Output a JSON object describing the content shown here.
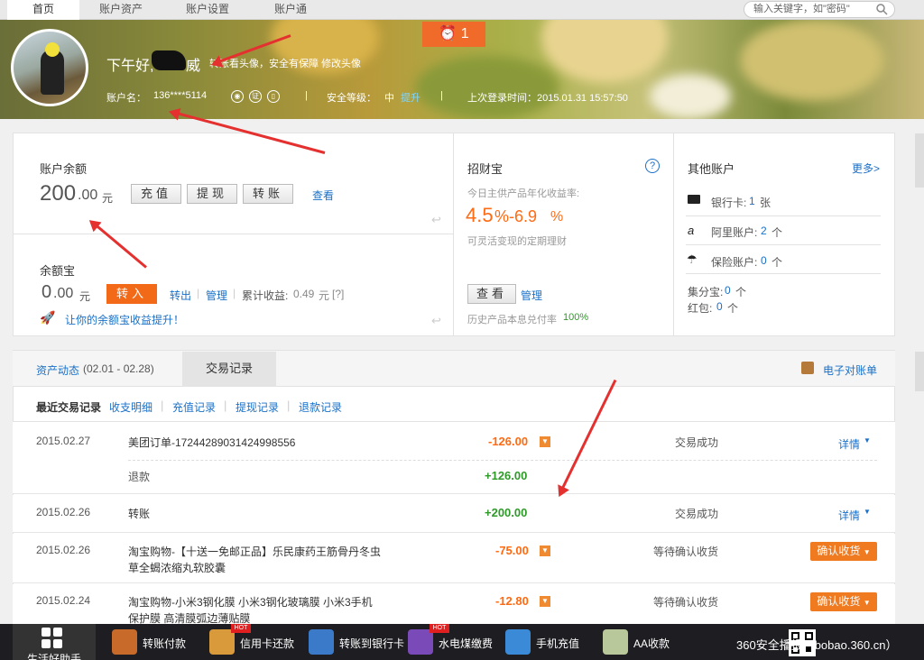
{
  "nav": {
    "tabs": [
      "首页",
      "账户资产",
      "账户设置",
      "账户通"
    ],
    "search_placeholder": "输入关键字，如\"密码\""
  },
  "header": {
    "greeting": "下午好,",
    "name_suffix": "威",
    "note": "转账看头像，安全有保障",
    "change_avatar": "修改头像",
    "account_label": "账户名：",
    "account_value": "136****5114",
    "security_label": "安全等级：",
    "security_level": "中",
    "security_upgrade": "提升",
    "last_login": "上次登录时间：2015.01.31 15:57:50",
    "alarm_count": "1"
  },
  "balance": {
    "title": "账户余额",
    "amount_int": "200",
    "amount_dec": ".00",
    "unit": "元",
    "recharge": "充值",
    "withdraw": "提现",
    "transfer": "转账",
    "view": "查看"
  },
  "yuebao": {
    "title": "余额宝",
    "amount_int": "0",
    "amount_dec": ".00",
    "unit": "元",
    "transfer_in": "转入",
    "transfer_out": "转出",
    "manage": "管理",
    "cumulative_label": "累计收益:",
    "cumulative_value": "0.49",
    "cumulative_unit": "元",
    "cumulative_q": "[?]",
    "promo": "让你的余额宝收益提升！"
  },
  "zhaocaibao": {
    "title": "招财宝",
    "subtitle": "今日主供产品年化收益率:",
    "rate_low": "4.5",
    "rate_mid": "%-6.9",
    "rate_pct": "%",
    "desc": "可灵活变现的定期理财",
    "view": "查看",
    "manage": "管理",
    "history_label": "历史产品本息兑付率",
    "history_value": "100%"
  },
  "other_accounts": {
    "title": "其他账户",
    "more": "更多>",
    "bank_label": "银行卡:",
    "bank_value": "1",
    "bank_unit": "张",
    "ali_label": "阿里账户:",
    "ali_value": "2",
    "ali_unit": "个",
    "ins_label": "保险账户:",
    "ins_value": "0",
    "ins_unit": "个",
    "jifen_label": "集分宝:",
    "jifen_value": "0",
    "jifen_unit": "个",
    "hongbao_label": "红包:",
    "hongbao_value": "0",
    "hongbao_unit": "个"
  },
  "records": {
    "tab_assets": "资产动态",
    "tab_assets_range": "(02.01 - 02.28)",
    "tab_trades": "交易记录",
    "e_statement": "电子对账单",
    "filter_title": "最近交易记录",
    "filters": [
      "收支明细",
      "充值记录",
      "提现记录",
      "退款记录"
    ],
    "rows": [
      {
        "date": "2015.02.27",
        "desc": "美团订单-17244289031424998556",
        "amount": "-126.00",
        "status": "交易成功",
        "action": "详情"
      },
      {
        "date": "",
        "desc": "退款",
        "amount": "+126.00",
        "status": "",
        "action": ""
      },
      {
        "date": "2015.02.26",
        "desc": "转账",
        "amount": "+200.00",
        "status": "交易成功",
        "action": "详情"
      },
      {
        "date": "2015.02.26",
        "desc": "淘宝购物-【十送一免邮正品】乐民康药王筋骨丹冬虫",
        "desc2": "草全蝎浓缩丸软胶囊",
        "amount": "-75.00",
        "status": "等待确认收货",
        "action": "确认收货"
      },
      {
        "date": "2015.02.24",
        "desc": "淘宝购物-小米3钢化膜 小米3钢化玻璃膜 小米3手机",
        "desc2": "保护膜 高清膜弧边薄贴膜",
        "amount": "-12.80",
        "status": "等待确认收货",
        "action": "确认收货"
      }
    ]
  },
  "dock": {
    "helper": "生活好助手",
    "items": [
      "转账付款",
      "信用卡还款",
      "转账到银行卡",
      "水电煤缴费",
      "手机充值",
      "AA收款"
    ],
    "hot": "HOT",
    "watermark": "360安全播报（bobao.360.cn）"
  }
}
